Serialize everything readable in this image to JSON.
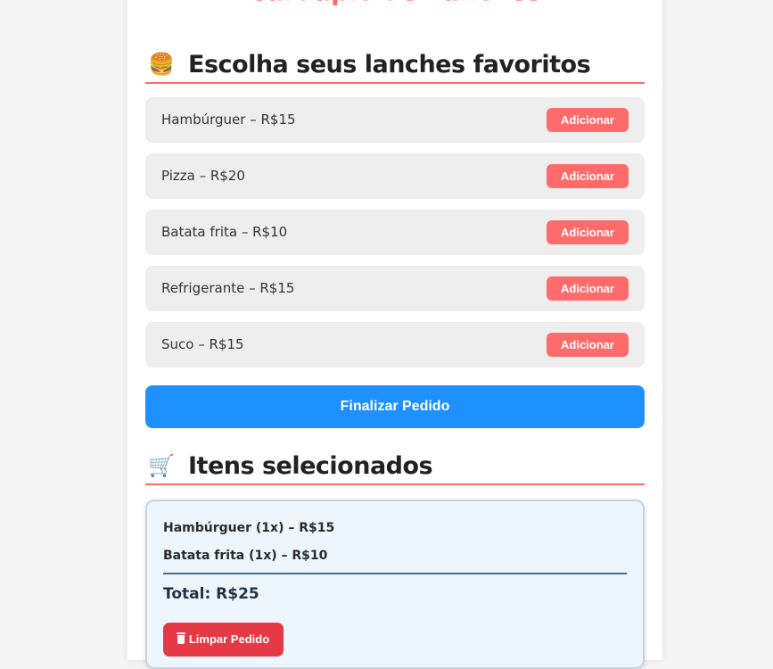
{
  "page": {
    "title": "Cardápio de Lanches"
  },
  "menu_section": {
    "icon": "burger-icon",
    "icon_glyph": "🍔",
    "heading": "Escolha seus lanches favoritos"
  },
  "menu_items": [
    {
      "label": "Hambúrguer – R$15",
      "button": "Adicionar"
    },
    {
      "label": "Pizza – R$20",
      "button": "Adicionar"
    },
    {
      "label": "Batata frita – R$10",
      "button": "Adicionar"
    },
    {
      "label": "Refrigerante – R$15",
      "button": "Adicionar"
    },
    {
      "label": "Suco – R$15",
      "button": "Adicionar"
    }
  ],
  "finalize_button": "Finalizar Pedido",
  "cart_section": {
    "icon": "shopping-cart-icon",
    "icon_glyph": "🛒",
    "heading": "Itens selecionados"
  },
  "order": {
    "items": [
      "Hambúrguer (1x) – R$15",
      "Batata frita (1x) – R$10"
    ],
    "total": "Total: R$25",
    "clear_button": "Limpar Pedido",
    "clear_icon": "trash-icon"
  },
  "colors": {
    "accent": "#ff6b6b",
    "primary_button": "#1e90ff",
    "danger_button": "#e63946",
    "item_background": "#eeeeee",
    "order_background": "#eef6fd"
  }
}
